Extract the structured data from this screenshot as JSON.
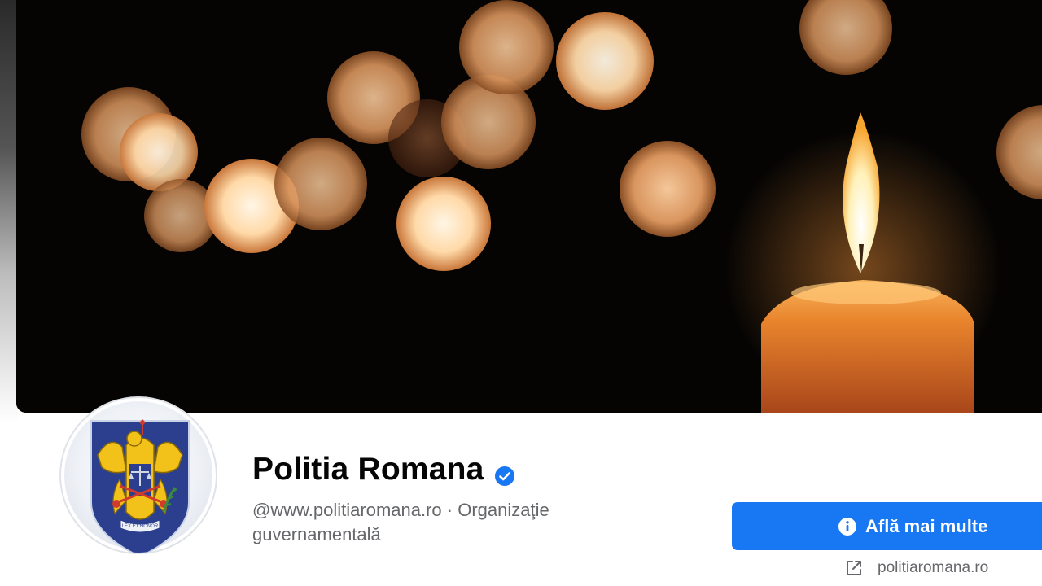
{
  "profile": {
    "name": "Politia Romana",
    "verified": true,
    "username": "@www.politiaromana.ro",
    "separator": " · ",
    "category": "Organizaţie guvernamentală",
    "avatar_motto": "LEX ET HONOR"
  },
  "actions": {
    "primary_button_label": "Află mai multe",
    "website_link": "politiaromana.ro"
  },
  "icons": {
    "verified": "verified-badge-icon",
    "primary_button": "info-icon",
    "website": "external-link-icon"
  },
  "colors": {
    "accent": "#1877f2",
    "text_primary": "#050505",
    "text_secondary": "#65676b",
    "cover_background": "#050403",
    "candle_wax": "#e07a25",
    "emblem_shield": "#2b3f8e",
    "emblem_gold": "#f2c21b"
  }
}
